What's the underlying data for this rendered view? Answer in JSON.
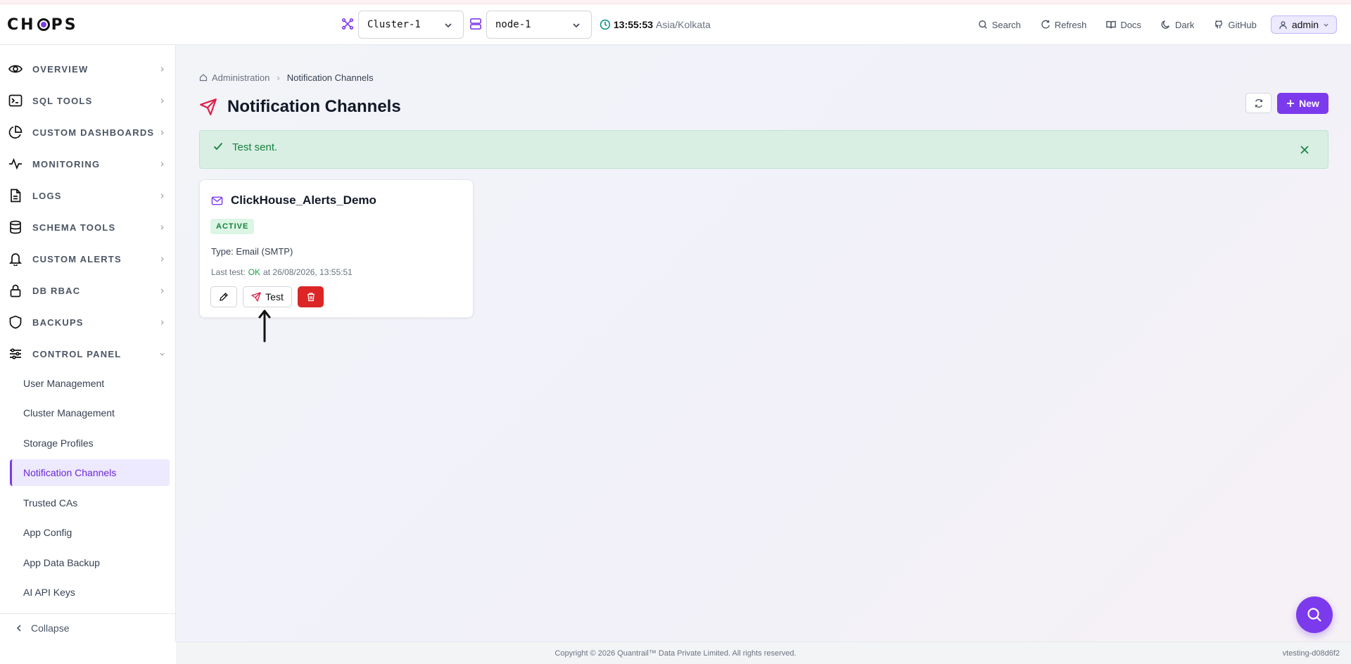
{
  "app": {
    "logo_text": "CHOPS"
  },
  "header": {
    "cluster_select": "Cluster-1",
    "node_select": "node-1",
    "time": "13:55:53",
    "timezone": "Asia/Kolkata",
    "links": {
      "search": "Search",
      "refresh": "Refresh",
      "docs": "Docs",
      "dark": "Dark",
      "github": "GitHub"
    },
    "user": "admin"
  },
  "sidebar": {
    "items": [
      {
        "label": "OVERVIEW",
        "icon": "eye-icon"
      },
      {
        "label": "SQL TOOLS",
        "icon": "terminal-icon"
      },
      {
        "label": "CUSTOM DASHBOARDS",
        "icon": "pie-chart-icon"
      },
      {
        "label": "MONITORING",
        "icon": "activity-icon"
      },
      {
        "label": "LOGS",
        "icon": "file-text-icon"
      },
      {
        "label": "SCHEMA TOOLS",
        "icon": "database-icon"
      },
      {
        "label": "CUSTOM ALERTS",
        "icon": "bell-icon"
      },
      {
        "label": "DB RBAC",
        "icon": "lock-icon"
      },
      {
        "label": "BACKUPS",
        "icon": "shield-icon"
      },
      {
        "label": "CONTROL PANEL",
        "icon": "sliders-icon"
      }
    ],
    "sub_items": [
      {
        "label": "User Management"
      },
      {
        "label": "Cluster Management"
      },
      {
        "label": "Storage Profiles"
      },
      {
        "label": "Notification Channels",
        "active": true
      },
      {
        "label": "Trusted CAs"
      },
      {
        "label": "App Config"
      },
      {
        "label": "App Data Backup"
      },
      {
        "label": "AI API Keys"
      }
    ],
    "collapse_label": "Collapse"
  },
  "breadcrumb": {
    "root": "Administration",
    "current": "Notification Channels"
  },
  "page": {
    "title": "Notification Channels",
    "new_label": "New"
  },
  "alert": {
    "message": "Test sent."
  },
  "channel": {
    "name": "ClickHouse_Alerts_Demo",
    "status": "ACTIVE",
    "type_text": "Type: Email (SMTP)",
    "last_test_prefix": "Last test:",
    "last_test_status": "OK",
    "last_test_time": "at 26/08/2026, 13:55:51",
    "test_label": "Test"
  },
  "footer": {
    "copyright": "Copyright © 2026 Quantrail™ Data Private Limited. All rights reserved.",
    "version": "vtesting-d08d6f2"
  },
  "colors": {
    "accent": "#7c3aed",
    "success": "#15803d",
    "danger": "#dc2626",
    "title_icon": "#e11d48"
  }
}
